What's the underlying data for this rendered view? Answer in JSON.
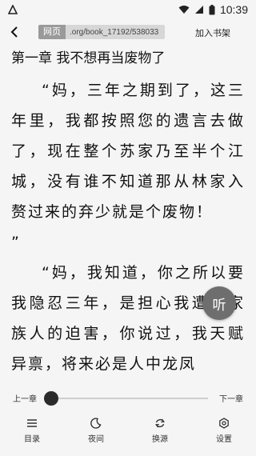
{
  "status_bar": {
    "time": "10:39",
    "icons": [
      "app-notification-icon",
      "wifi-icon",
      "cellular-icon",
      "battery-icon"
    ]
  },
  "topbar": {
    "url_tag": "网页",
    "url_text": ".org/book_17192/538033",
    "add_to_shelf": "加入书架"
  },
  "chapter": {
    "title": "第一章 我不想再当废物了",
    "paragraphs": [
      "“妈，三年之期到了，这三年里，我都按照您的遗言去做了，现在整个苏家乃至半个江城，没有谁不知道那从林家入赘过来的弃少就是个废物！",
      "”",
      "“妈，我知道，你之所以要我隐忍三年，是担心我遭受家族人的迫害，你说过，我天赋异禀，将来必是人中龙凤"
    ]
  },
  "listen_button": "听",
  "progress": {
    "prev_label": "上一章",
    "next_label": "下一章",
    "position": 0.0
  },
  "bottom_nav": [
    {
      "label": "目录",
      "icon": "menu-icon"
    },
    {
      "label": "夜间",
      "icon": "moon-icon"
    },
    {
      "label": "换源",
      "icon": "refresh-icon"
    },
    {
      "label": "设置",
      "icon": "settings-icon"
    }
  ]
}
